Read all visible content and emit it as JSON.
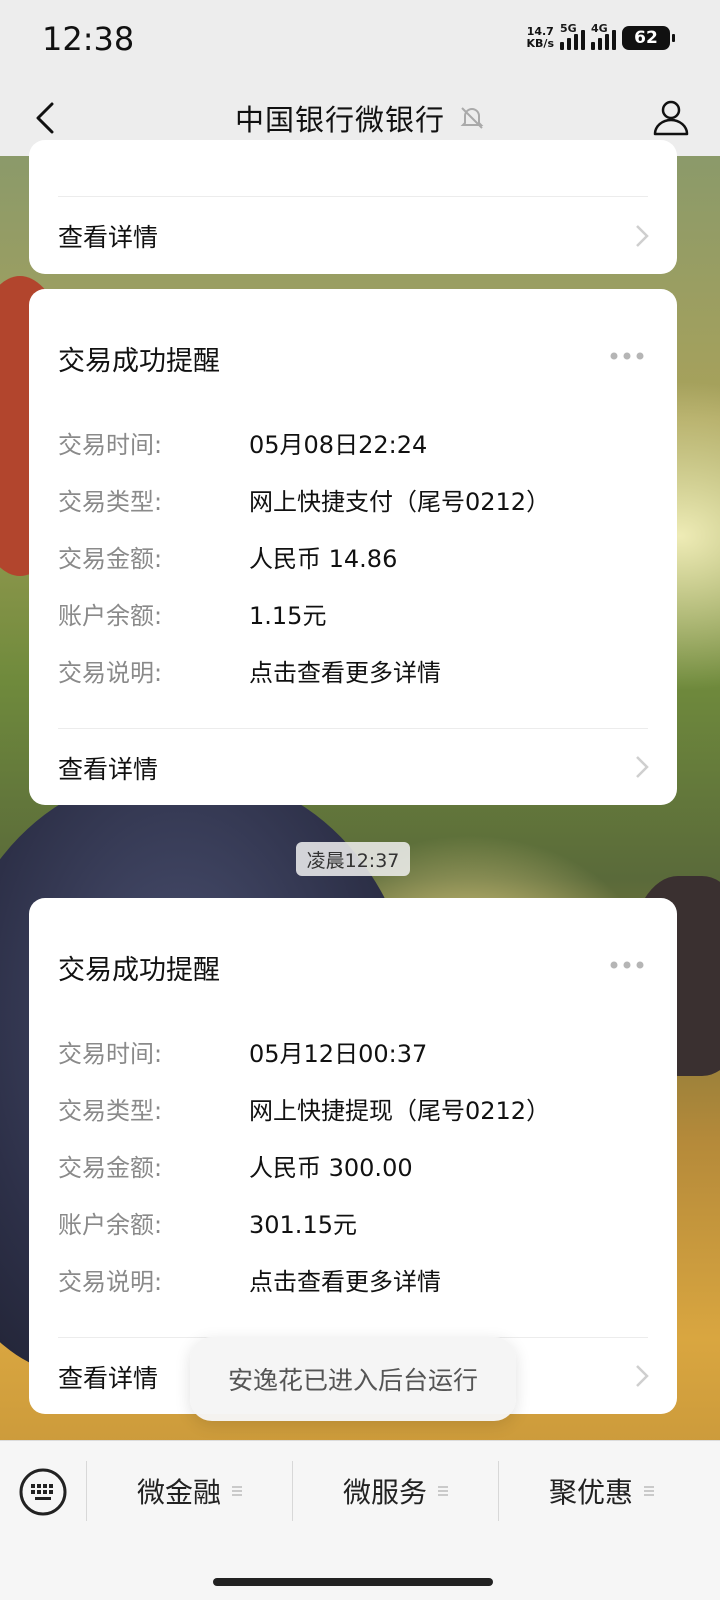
{
  "status_bar": {
    "time": "12:38",
    "net_speed_value": "14.7",
    "net_speed_unit": "KB/s",
    "sig1_label": "5G",
    "sig2_label": "4G",
    "battery": "62"
  },
  "header": {
    "title": "中国银行微银行"
  },
  "cards": [
    {
      "detail_link": "查看详情"
    },
    {
      "title": "交易成功提醒",
      "fields": [
        {
          "label": "交易时间:",
          "value": "05月08日22:24"
        },
        {
          "label": "交易类型:",
          "value": "网上快捷支付（尾号0212）"
        },
        {
          "label": "交易金额:",
          "value": "人民币 14.86"
        },
        {
          "label": "账户余额:",
          "value": "1.15元"
        },
        {
          "label": "交易说明:",
          "value": "点击查看更多详情"
        }
      ],
      "detail_link": "查看详情"
    },
    {
      "title": "交易成功提醒",
      "fields": [
        {
          "label": "交易时间:",
          "value": "05月12日00:37"
        },
        {
          "label": "交易类型:",
          "value": "网上快捷提现（尾号0212）"
        },
        {
          "label": "交易金额:",
          "value": "人民币 300.00"
        },
        {
          "label": "账户余额:",
          "value": "301.15元"
        },
        {
          "label": "交易说明:",
          "value": "点击查看更多详情"
        }
      ],
      "detail_link": "查看详情"
    }
  ],
  "time_separator": "凌晨12:37",
  "toast": "安逸花已进入后台运行",
  "bottom_menu": {
    "items": [
      "微金融",
      "微服务",
      "聚优惠"
    ]
  },
  "colors": {
    "background": "#ededed",
    "card": "#ffffff",
    "label_gray": "#8a8a8a"
  }
}
